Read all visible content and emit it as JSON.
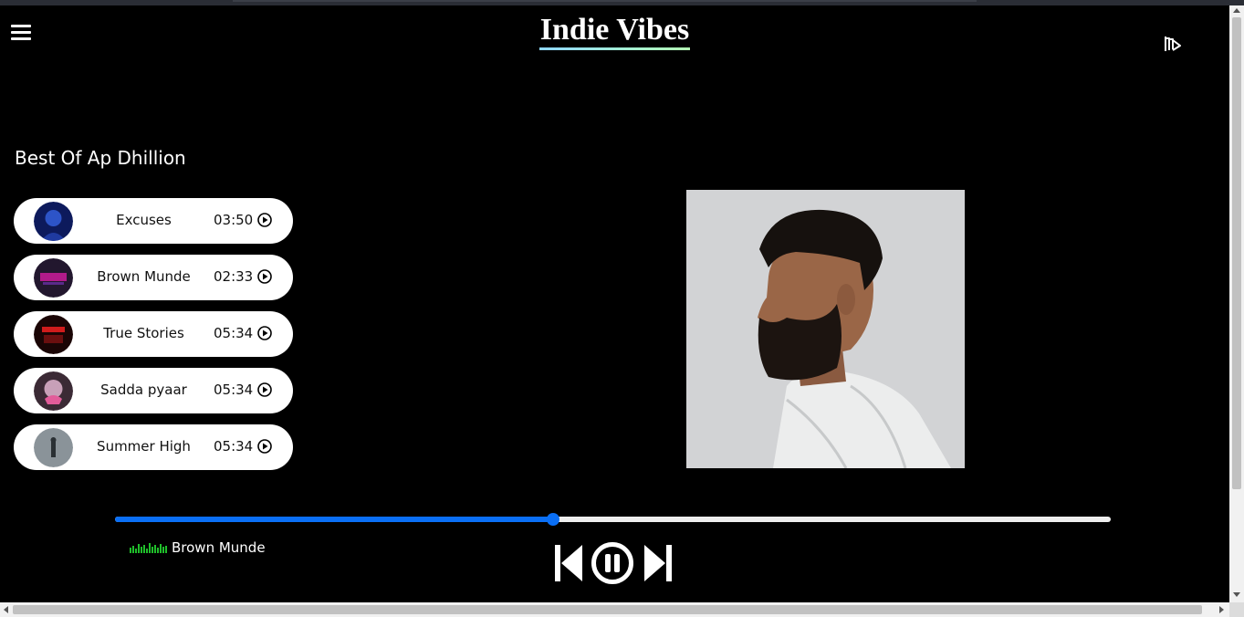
{
  "header": {
    "title": "Indie Vibes",
    "menu_icon": "hamburger-menu-icon",
    "logo_icon": "app-logo-icon"
  },
  "playlist": {
    "title": "Best Of Ap Dhillion",
    "songs": [
      {
        "name": "Excuses",
        "duration": "03:50",
        "thumb_color": "#1a2a7a"
      },
      {
        "name": "Brown Munde",
        "duration": "02:33",
        "thumb_color": "#2a1a3a"
      },
      {
        "name": "True Stories",
        "duration": "05:34",
        "thumb_color": "#3a0a0a"
      },
      {
        "name": "Sadda pyaar",
        "duration": "05:34",
        "thumb_color": "#4a2a3a"
      },
      {
        "name": "Summer High",
        "duration": "05:34",
        "thumb_color": "#5a646a"
      }
    ]
  },
  "player": {
    "progress": 0.44,
    "now_playing": "Brown Munde",
    "eq_icon": "equalizer-icon",
    "prev_icon": "skip-previous-icon",
    "pause_icon": "pause-icon",
    "next_icon": "skip-next-icon"
  },
  "colors": {
    "accent": "#0a6ff5",
    "background": "#000000",
    "card": "#ffffff",
    "eq_green": "#1fbf2a"
  }
}
